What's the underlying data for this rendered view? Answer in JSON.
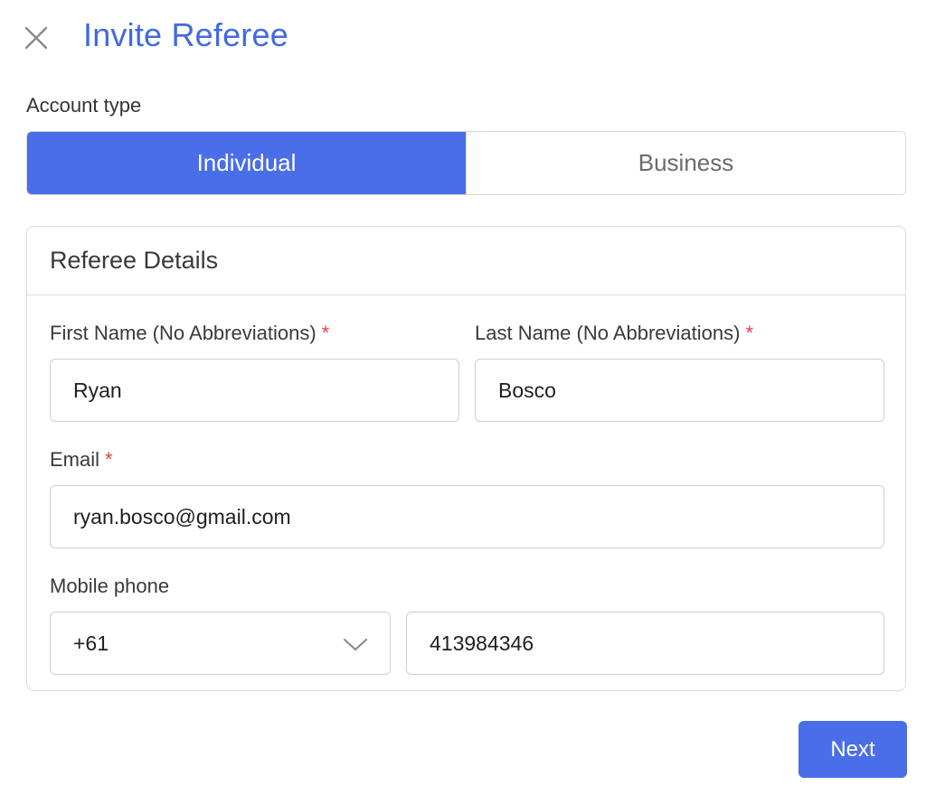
{
  "header": {
    "title": "Invite Referee",
    "close_icon": "close-icon"
  },
  "account_type": {
    "label": "Account type",
    "options": [
      "Individual",
      "Business"
    ],
    "selected": "Individual"
  },
  "referee_details": {
    "section_title": "Referee Details",
    "first_name": {
      "label": "First Name (No Abbreviations)",
      "required_mark": "*",
      "value": "Ryan"
    },
    "last_name": {
      "label": "Last Name (No Abbreviations)",
      "required_mark": "*",
      "value": "Bosco"
    },
    "email": {
      "label": "Email",
      "required_mark": "*",
      "value": "ryan.bosco@gmail.com"
    },
    "mobile_phone": {
      "label": "Mobile phone",
      "country_code": "+61",
      "number": "413984346",
      "dropdown_icon": "chevron-down-icon"
    }
  },
  "actions": {
    "next_label": "Next"
  },
  "colors": {
    "accent": "#4a6ee8",
    "title": "#4169e1",
    "required": "#e0404a"
  }
}
